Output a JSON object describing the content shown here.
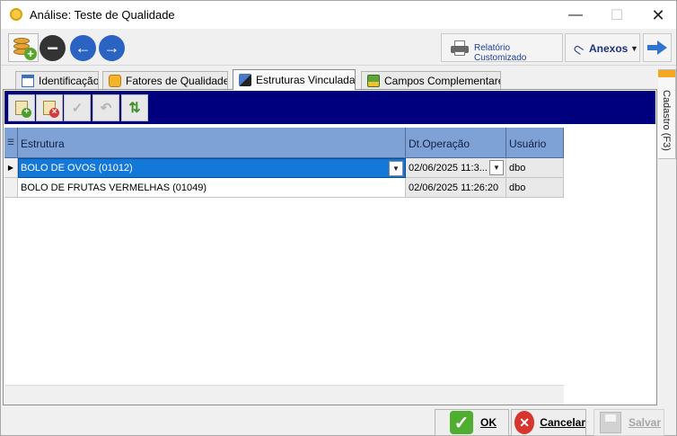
{
  "window": {
    "title": "Análise: Teste de Qualidade",
    "minimize_glyph": "—",
    "maximize_glyph": "☐",
    "close_glyph": "✕"
  },
  "toolbar": {
    "database_button": {
      "icon": "database-add-icon"
    },
    "remove_button": {
      "icon": "minus-circle-icon",
      "glyph": "−"
    },
    "previous_button": {
      "icon": "arrow-left-icon",
      "glyph": "←"
    },
    "next_record_button": {
      "icon": "arrow-right-icon",
      "glyph": "→"
    },
    "custom_report_label": "Relatório Customizado",
    "attachments_label": "Anexos",
    "attachments_caret": "▼",
    "forward_button": {
      "icon": "arrow-right-icon"
    }
  },
  "tabs": [
    {
      "label": "Identificação",
      "icon": "document-icon",
      "active": false
    },
    {
      "label": "Fatores de Qualidade",
      "icon": "quality-icon",
      "active": false
    },
    {
      "label": "Estruturas Vinculadas",
      "icon": "structure-icon",
      "active": true
    },
    {
      "label": "Campos Complementares",
      "icon": "fields-icon",
      "active": false
    }
  ],
  "side_tab": {
    "label": "Cadastro (F3)"
  },
  "subtoolbar": {
    "add_icon": "document-add-icon",
    "add_badge": "+",
    "delete_icon": "document-delete-icon",
    "delete_badge": "×",
    "confirm_glyph": "✓",
    "undo_glyph": "↶",
    "sort_glyph": "⇅"
  },
  "grid": {
    "indicator_glyph": "☰",
    "selected_glyph": "▶",
    "dropdown_glyph": "▼",
    "columns": [
      "Estrutura",
      "Dt.Operação",
      "Usuário"
    ],
    "rows": [
      {
        "estrutura": "BOLO DE OVOS  (01012)",
        "dt_operacao": "02/06/2025 11:3...",
        "usuario": "dbo",
        "selected": true
      },
      {
        "estrutura": "BOLO DE FRUTAS VERMELHAS  (01049)",
        "dt_operacao": "02/06/2025 11:26:20",
        "usuario": "dbo",
        "selected": false
      }
    ]
  },
  "footer": {
    "ok_label": "OK",
    "ok_glyph": "✓",
    "cancel_label": "Cancelar",
    "cancel_glyph": "✕",
    "save_label": "Salvar",
    "save_enabled": false
  }
}
